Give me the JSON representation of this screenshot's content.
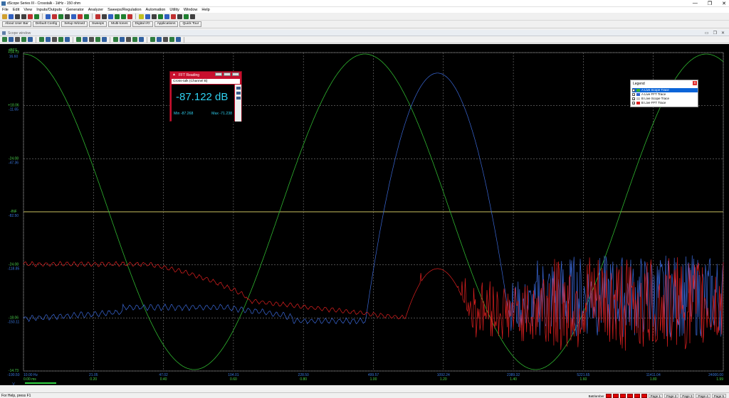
{
  "window": {
    "title": "dScope Series III - Crosstalk - 1kHz - 150 ohm",
    "controls": [
      "—",
      "❐",
      "✕"
    ]
  },
  "menu": [
    "File",
    "Edit",
    "View",
    "Inputs/Outputs",
    "Generator",
    "Analyzer",
    "Sweeps/Regulation",
    "Automation",
    "Utility",
    "Window",
    "Help"
  ],
  "quick_buttons": [
    "About User Bar",
    "Default Config",
    "Setup Wizard",
    "Sweeps",
    "Multi-tones",
    "Digital I/O",
    "Applications",
    "Quick Tour"
  ],
  "child_window": {
    "title": "Scope window",
    "controls": [
      "▭",
      "❐",
      "✕"
    ]
  },
  "fft_reading": {
    "title": "FFT Reading",
    "channel": "Cross-talk (Channel B)",
    "value": "-87.122 dB",
    "min": "Min -87.268",
    "max": "Max -71.238"
  },
  "legend": {
    "title": "Legend",
    "close": "x",
    "items": [
      {
        "label": "A Live Scope Trace",
        "color": "#2fb52f",
        "selected": true
      },
      {
        "label": "A Live FFT Trace",
        "color": "#3060d0",
        "selected": false
      },
      {
        "label": "B Live Scope Trace",
        "color": "#c8c8c8",
        "selected": false
      },
      {
        "label": "B Live FFT Trace",
        "color": "#e02020",
        "selected": false
      }
    ]
  },
  "axes": {
    "y_unit_top": "dBFS",
    "y_unit_secondary": "V",
    "x_unit_top": "Hz",
    "x_unit_bottom": "ms",
    "y_labels": [
      {
        "primary": "+14.73",
        "secondary": "16.60"
      },
      {
        "primary": "+18.06",
        "secondary": "-11.65"
      },
      {
        "primary": "-24.08",
        "secondary": "-47.36"
      },
      {
        "primary": "-INF",
        "secondary": "-82.50"
      },
      {
        "primary": "-24.08",
        "secondary": "-118.85"
      },
      {
        "primary": "-18.06",
        "secondary": "-150.11"
      },
      {
        "primary": "-14.73",
        "secondary": "-190.50"
      }
    ],
    "x_labels_top": [
      "10.00 Hz",
      "21.05",
      "47.02",
      "104.01",
      "228.50",
      "499.57",
      "1092.24",
      "2389.32",
      "5221.65",
      "11411.04",
      "24000.00"
    ],
    "x_labels_bottom": [
      "0.00 ms",
      "0.20",
      "0.40",
      "0.60",
      "0.80",
      "1.00",
      "1.20",
      "1.40",
      "1.60",
      "1.80",
      "1.99"
    ]
  },
  "chart_data": {
    "type": "line",
    "title": "",
    "x_scale": "log",
    "xlim": [
      10,
      24000
    ],
    "series": [
      {
        "name": "A Live Scope Trace",
        "color": "#2fb52f",
        "kind": "sine",
        "cycles": 2.05,
        "phase_deg": -90
      },
      {
        "name": "A Live FFT Trace",
        "color": "#3a68d8",
        "peak_hz": 1000,
        "peak_dbfs": -9,
        "noise_floor_dbfs": -118
      },
      {
        "name": "B Live FFT Trace",
        "color": "#e02020",
        "peak_hz": 1000,
        "peak_dbfs": -95,
        "noise_floor_dbfs": -122
      }
    ]
  },
  "status": {
    "help": "For Help, press F1",
    "fields": [
      "Page 1",
      "Page 2",
      "Page 3",
      "Page 4",
      "Page 5"
    ],
    "battery_label": "Batt/amber"
  }
}
